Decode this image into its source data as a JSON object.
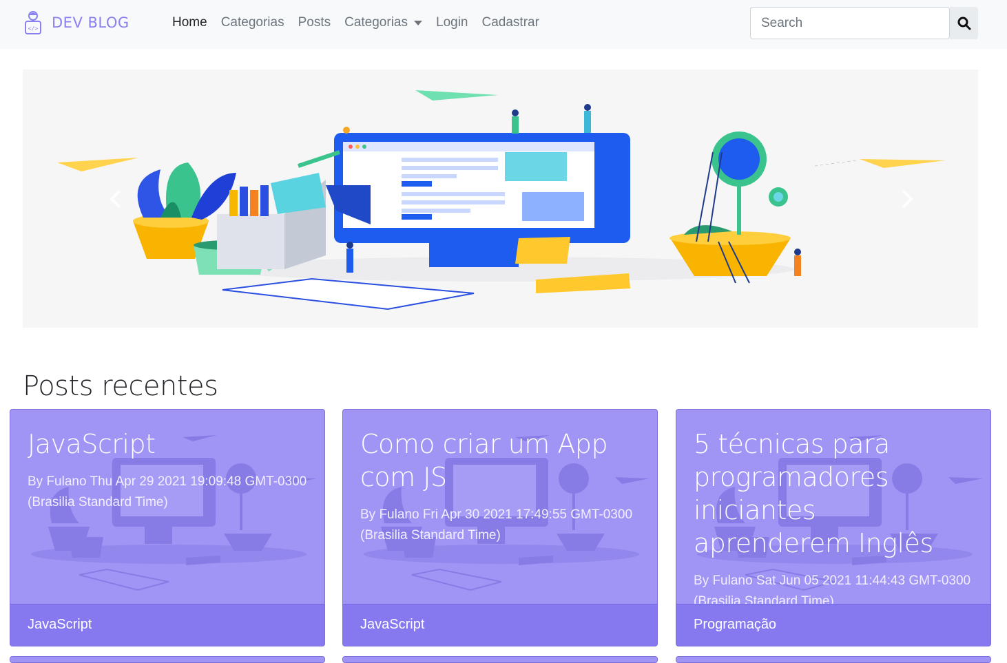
{
  "brand": {
    "name": "DEV BLOG",
    "logo": "developer-avatar-icon"
  },
  "nav": {
    "links": [
      {
        "label": "Home",
        "active": true
      },
      {
        "label": "Categorias"
      },
      {
        "label": "Posts"
      },
      {
        "label": "Categorias",
        "dropdown": true
      },
      {
        "label": "Login"
      },
      {
        "label": "Cadastrar"
      }
    ]
  },
  "search": {
    "placeholder": "Search",
    "button_icon": "search-icon"
  },
  "carousel": {
    "prev_icon": "chevron-left-icon",
    "next_icon": "chevron-right-icon"
  },
  "section": {
    "title": "Posts recentes"
  },
  "posts": [
    {
      "title": "JavaScript",
      "meta": "By Fulano Thu Apr 29 2021 19:09:48 GMT-0300 (Brasilia Standard Time)",
      "category": "JavaScript"
    },
    {
      "title": "Como criar um App com JS",
      "meta": "By Fulano Fri Apr 30 2021 17:49:55 GMT-0300 (Brasilia Standard Time)",
      "category": "JavaScript"
    },
    {
      "title": "5 técnicas para programadores iniciantes aprenderem Inglês",
      "meta": "By Fulano Sat Jun 05 2021 11:44:43 GMT-0300 (Brasilia Standard Time)",
      "category": "Programação"
    }
  ],
  "colors": {
    "brand": "#8b80f0",
    "card_bg": "#a095f5",
    "card_footer": "#8679f0"
  }
}
